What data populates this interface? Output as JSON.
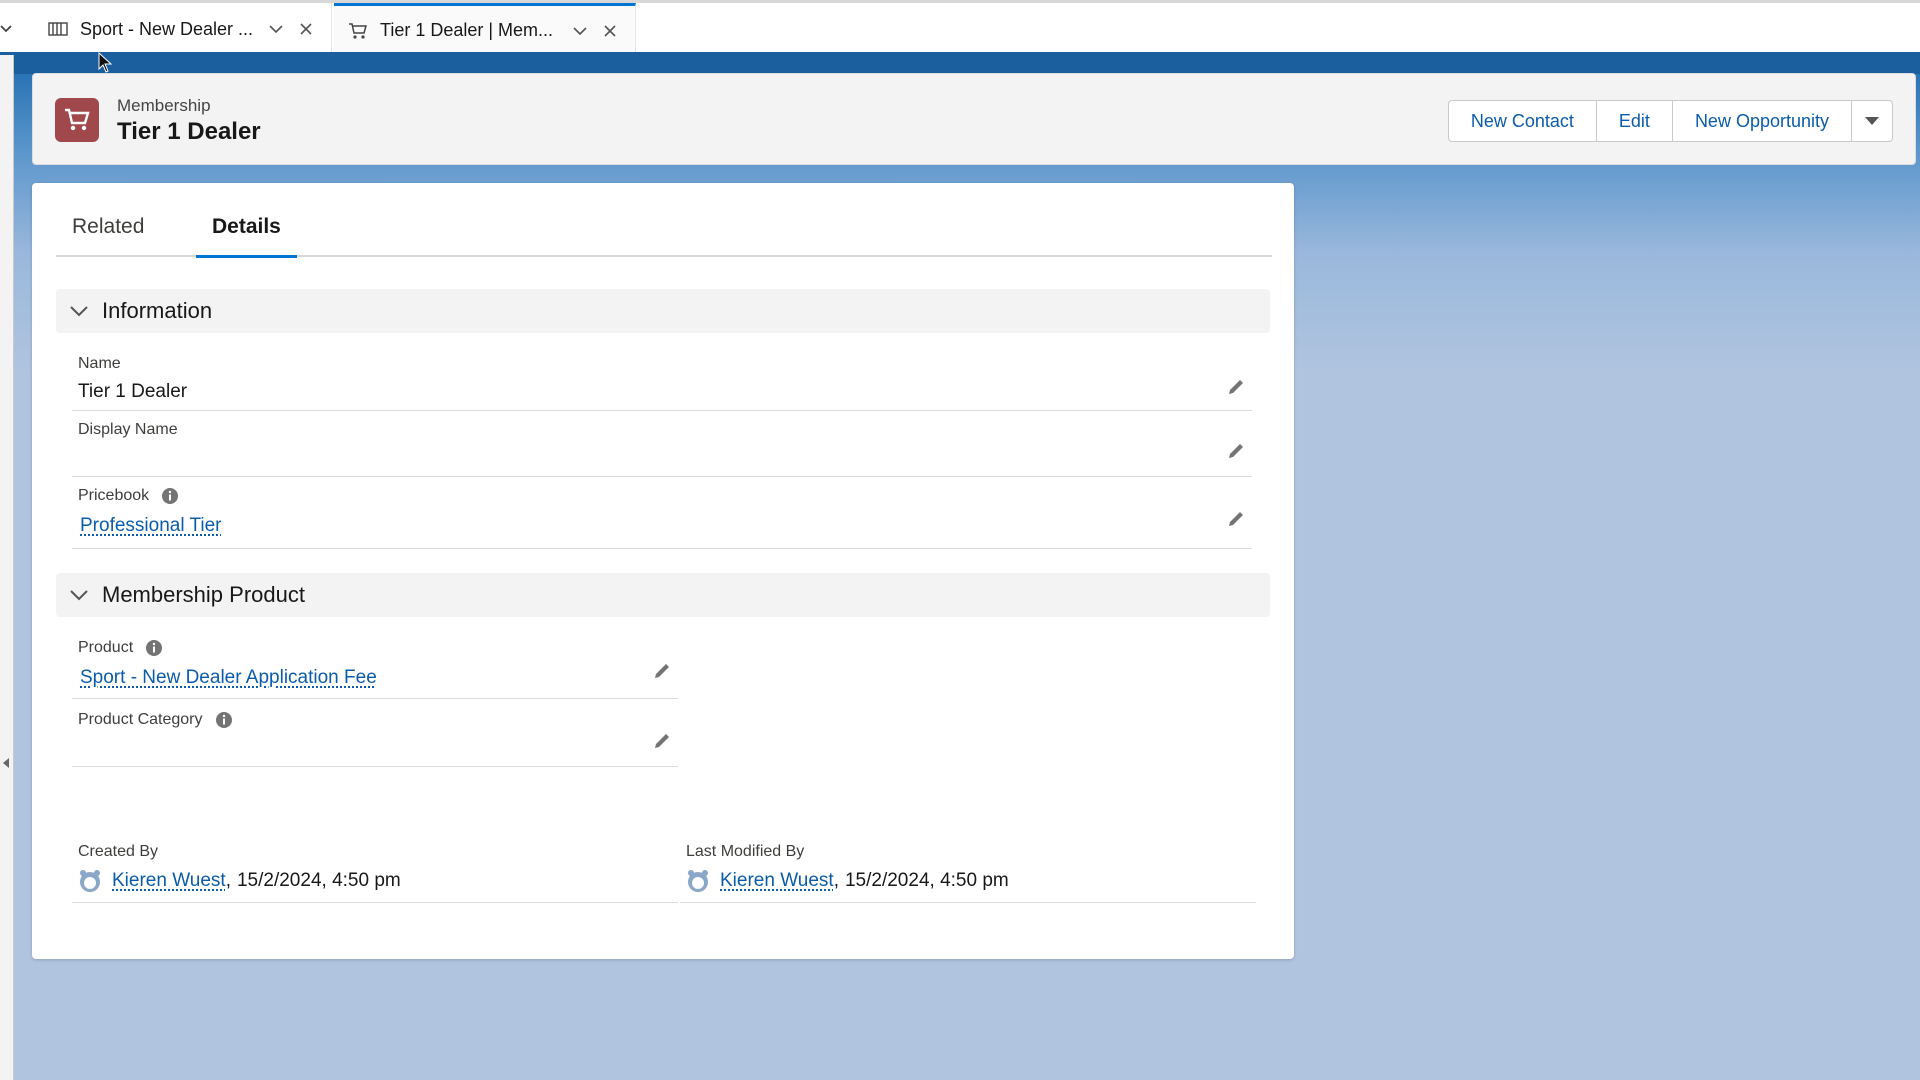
{
  "tabs": [
    {
      "label": "Sport - New Dealer ...",
      "icon": "product-icon"
    },
    {
      "label": "Tier 1 Dealer | Mem...",
      "icon": "cart-icon",
      "active": true
    }
  ],
  "header": {
    "record_type": "Membership",
    "title": "Tier 1 Dealer",
    "icon": "cart-icon",
    "icon_color": "#a0484c"
  },
  "actions": {
    "new_contact": "New Contact",
    "edit": "Edit",
    "new_opportunity": "New Opportunity"
  },
  "record_tabs": {
    "related": "Related",
    "details": "Details"
  },
  "sections": {
    "information": "Information",
    "membership_product": "Membership Product"
  },
  "fields": {
    "name": {
      "label": "Name",
      "value": "Tier 1 Dealer"
    },
    "display_name": {
      "label": "Display Name",
      "value": ""
    },
    "pricebook": {
      "label": "Pricebook",
      "value": "Professional Tier"
    },
    "product": {
      "label": "Product",
      "value": "Sport - New Dealer Application Fee"
    },
    "product_category": {
      "label": "Product Category",
      "value": ""
    }
  },
  "meta": {
    "created_by": {
      "label": "Created By",
      "user": "Kieren Wuest",
      "separator": ",",
      "date": "15/2/2024, 4:50 pm"
    },
    "last_modified_by": {
      "label": "Last Modified By",
      "user": "Kieren Wuest",
      "separator": ",",
      "date": "15/2/2024, 4:50 pm"
    }
  },
  "colors": {
    "accent": "#0176d3",
    "link": "#0b5cab",
    "brand_band": "#1b5f9e"
  }
}
